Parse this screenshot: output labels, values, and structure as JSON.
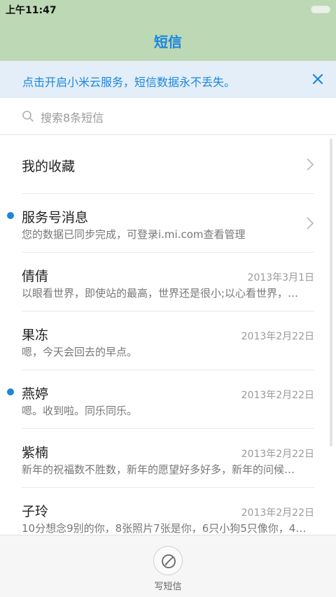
{
  "status_bar": {
    "time": "上午11:47"
  },
  "header": {
    "title": "短信"
  },
  "banner": {
    "text": "点击开启小米云服务，短信数据永不丢失。"
  },
  "search": {
    "placeholder": "搜索8条短信"
  },
  "favorites": {
    "label": "我的收藏"
  },
  "service": {
    "name": "服务号消息",
    "preview": "您的数据已同步完成，可登录i.mi.com查看管理",
    "unread": true
  },
  "conversations": [
    {
      "name": "倩倩",
      "date": "2013年3月1日",
      "preview": "以眼看世界，即使站的最高，世界还是很小;以心看世界，…",
      "unread": false
    },
    {
      "name": "果冻",
      "date": "2013年2月22日",
      "preview": "嗯，今天会回去的早点。",
      "unread": false
    },
    {
      "name": "燕婷",
      "date": "2013年2月22日",
      "preview": "嗯。收到啦。同乐同乐。",
      "unread": true
    },
    {
      "name": "紫楠",
      "date": "2013年2月22日",
      "preview": "新年的祝福数不胜数，新年的愿望好多好多，新年的问候…",
      "unread": false
    },
    {
      "name": "子玲",
      "date": "2013年2月22日",
      "preview": "10分想念9别的你，8张照片7张是你，6只小狗5只像你，4…",
      "unread": false
    }
  ],
  "bottom": {
    "compose_label": "写短信"
  },
  "colors": {
    "accent": "#1a86e0",
    "header_bg": "#bcd8b4",
    "banner_bg": "#e3eef8"
  }
}
